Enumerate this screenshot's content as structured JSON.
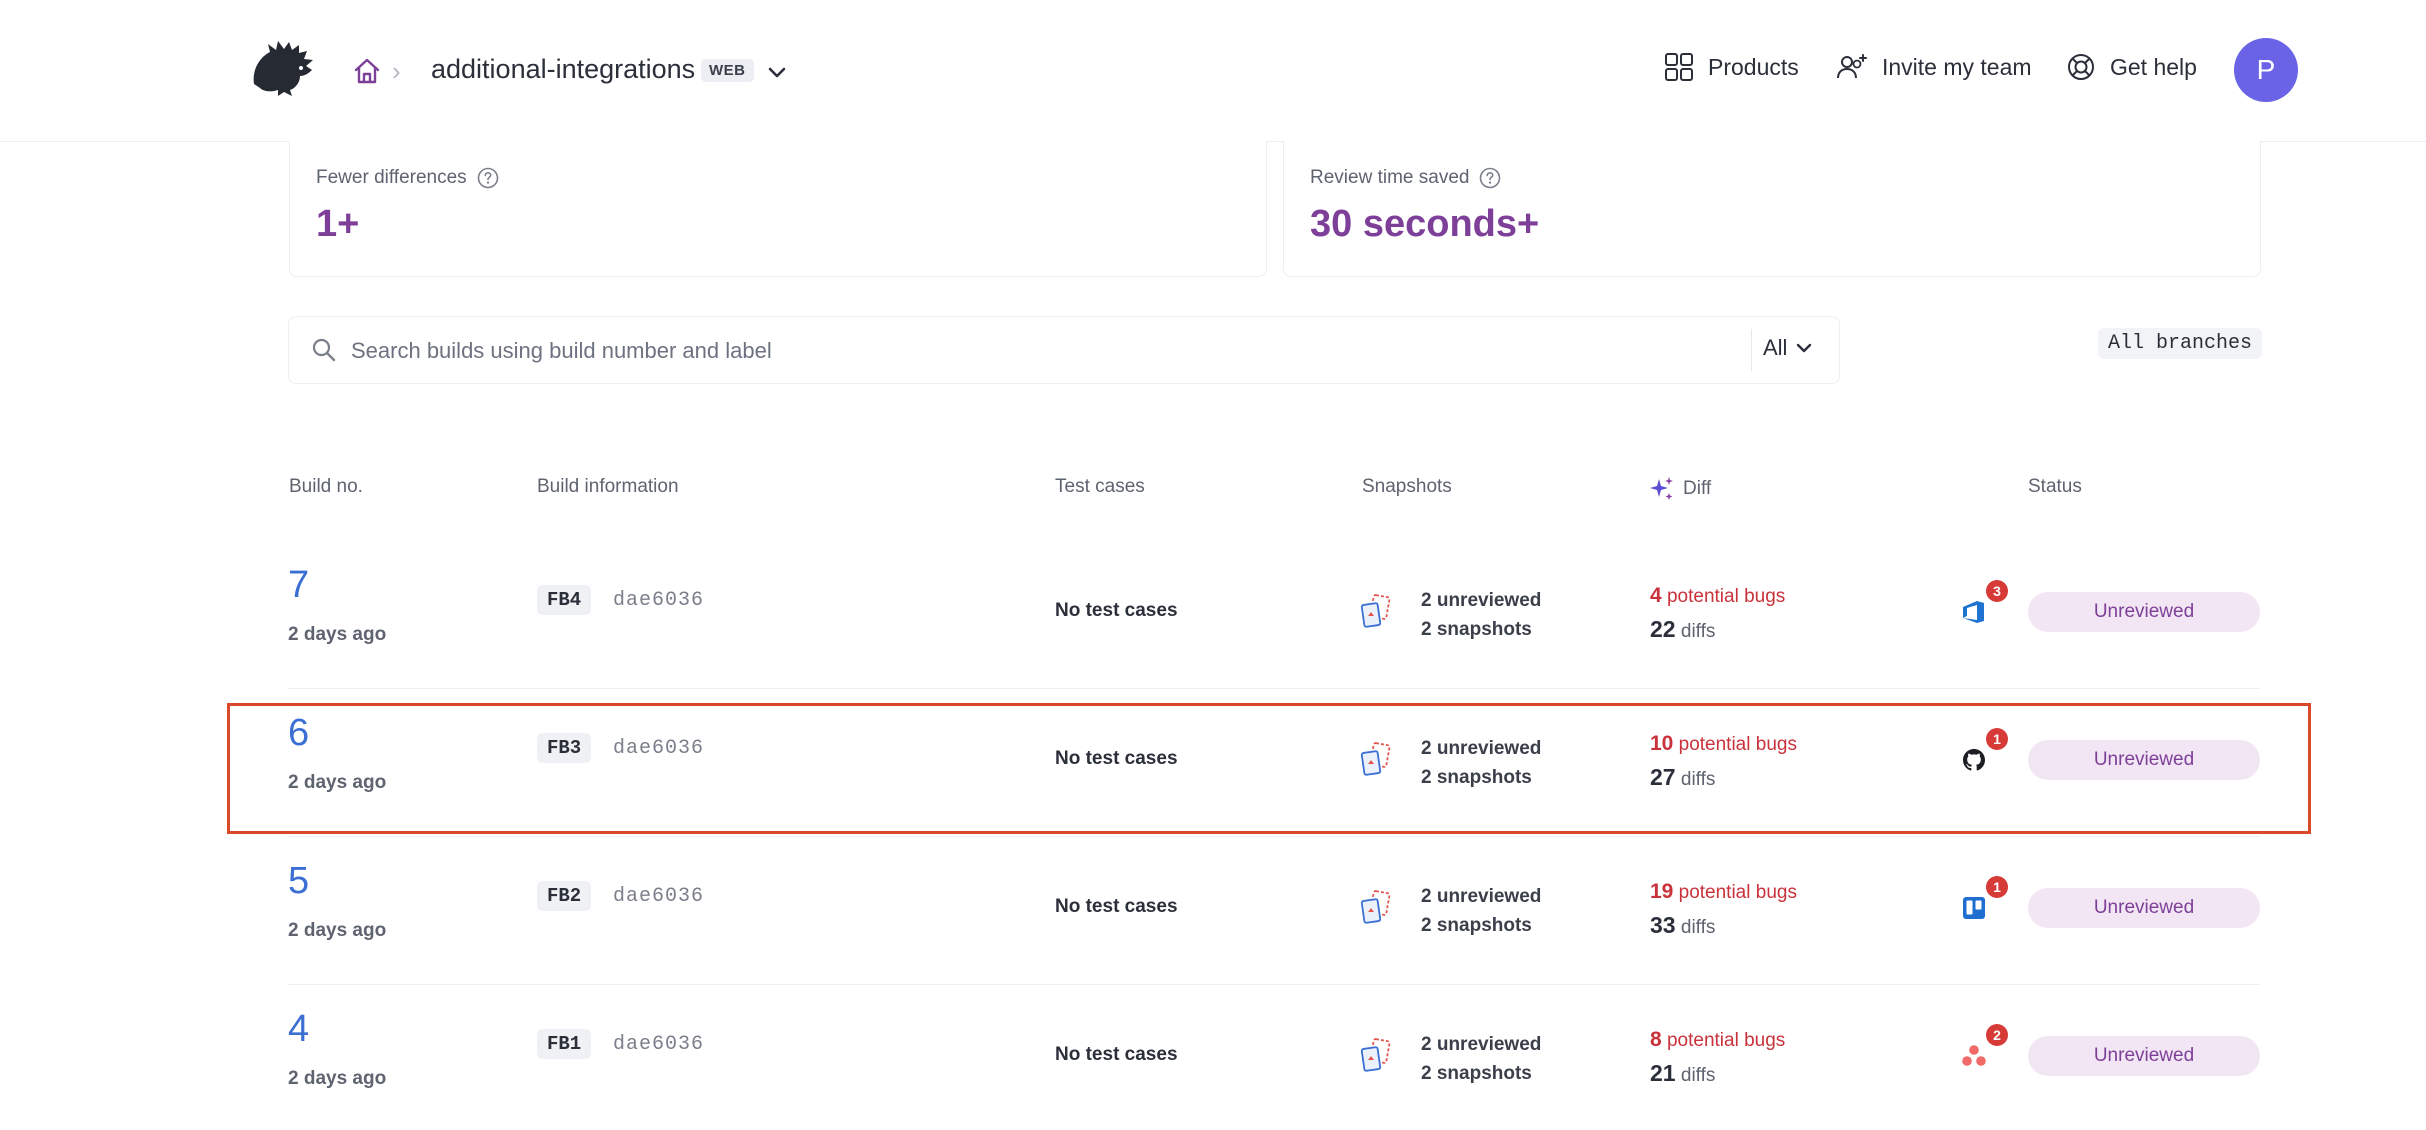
{
  "header": {
    "project_name": "additional-integrations",
    "platform_badge": "WEB",
    "nav": {
      "products": "Products",
      "invite": "Invite my team",
      "help": "Get help"
    },
    "avatar_initial": "P"
  },
  "metrics": [
    {
      "label": "Fewer differences",
      "value": "1+"
    },
    {
      "label": "Review time saved",
      "value": "30 seconds+"
    }
  ],
  "search": {
    "placeholder": "Search builds using build number and label",
    "filter_value": "All",
    "branches_label": "All branches"
  },
  "table": {
    "columns": {
      "build_no": "Build no.",
      "build_info": "Build information",
      "test_cases": "Test cases",
      "snapshots": "Snapshots",
      "diff": "Diff",
      "status": "Status"
    },
    "rows": [
      {
        "number": "7",
        "time": "2 days ago",
        "label": "FB4",
        "sha": "dae6036",
        "test_cases": "No test cases",
        "unreviewed": "2 unreviewed",
        "snapshots": "2 snapshots",
        "bugs_count": "4",
        "bugs_text": "potential bugs",
        "diffs_count": "22",
        "diffs_text": "diffs",
        "tool": "azure-devops-icon",
        "tool_count": "3",
        "status": "Unreviewed"
      },
      {
        "number": "6",
        "time": "2 days ago",
        "label": "FB3",
        "sha": "dae6036",
        "test_cases": "No test cases",
        "unreviewed": "2 unreviewed",
        "snapshots": "2 snapshots",
        "bugs_count": "10",
        "bugs_text": "potential bugs",
        "diffs_count": "27",
        "diffs_text": "diffs",
        "tool": "github-icon",
        "tool_count": "1",
        "status": "Unreviewed"
      },
      {
        "number": "5",
        "time": "2 days ago",
        "label": "FB2",
        "sha": "dae6036",
        "test_cases": "No test cases",
        "unreviewed": "2 unreviewed",
        "snapshots": "2 snapshots",
        "bugs_count": "19",
        "bugs_text": "potential bugs",
        "diffs_count": "33",
        "diffs_text": "diffs",
        "tool": "trello-icon",
        "tool_count": "1",
        "status": "Unreviewed"
      },
      {
        "number": "4",
        "time": "2 days ago",
        "label": "FB1",
        "sha": "dae6036",
        "test_cases": "No test cases",
        "unreviewed": "2 unreviewed",
        "snapshots": "2 snapshots",
        "bugs_count": "8",
        "bugs_text": "potential bugs",
        "diffs_count": "21",
        "diffs_text": "diffs",
        "tool": "asana-icon",
        "tool_count": "2",
        "status": "Unreviewed"
      }
    ]
  },
  "colors": {
    "accent": "#7d3f98",
    "link": "#3b6fd4",
    "bug": "#c9323b",
    "highlight": "#d94a2b",
    "avatar": "#6a63e6"
  }
}
